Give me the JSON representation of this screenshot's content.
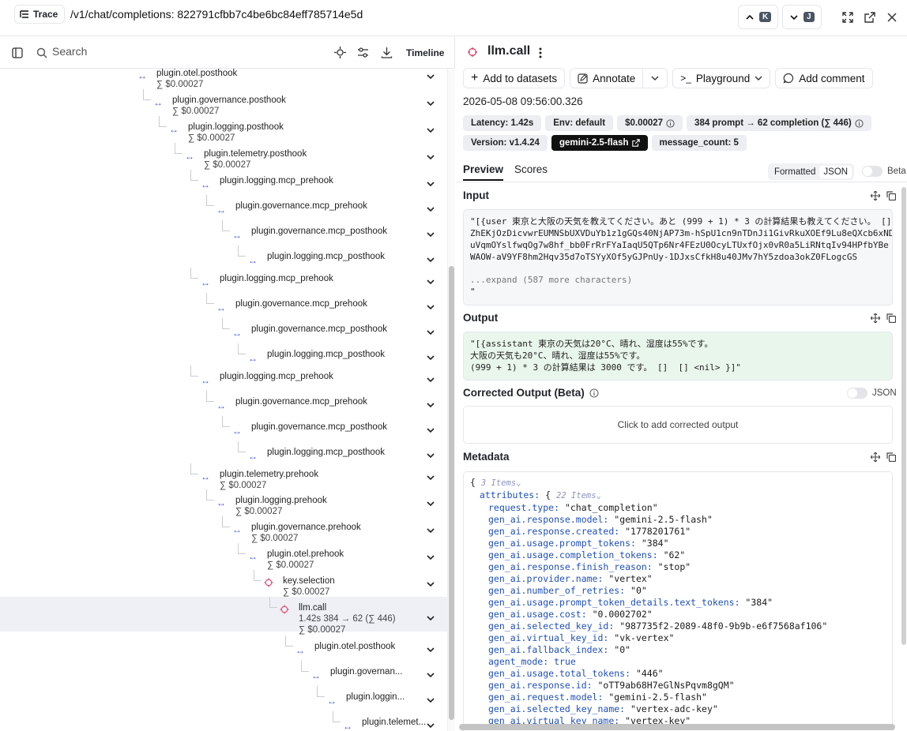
{
  "header": {
    "trace_label": "Trace",
    "path": "/v1/chat/completions: 822791cfbb7c4be6bc84eff785714e5d",
    "prev_key": "K",
    "next_key": "J"
  },
  "left": {
    "search_placeholder": "Search",
    "timeline_label": "Timeline",
    "tree": [
      {
        "name": "plugin.otel.posthook",
        "sub": "∑ $0.00027",
        "level": 0,
        "icon": "arrow"
      },
      {
        "name": "plugin.governance.posthook",
        "sub": "∑ $0.00027",
        "level": 1,
        "icon": "arrow"
      },
      {
        "name": "plugin.logging.posthook",
        "sub": "∑ $0.00027",
        "level": 2,
        "icon": "arrow"
      },
      {
        "name": "plugin.telemetry.posthook",
        "sub": "∑ $0.00027",
        "level": 3,
        "icon": "arrow"
      },
      {
        "name": "plugin.logging.mcp_prehook",
        "sub": "",
        "level": 4,
        "icon": "arrow"
      },
      {
        "name": "plugin.governance.mcp_prehook",
        "sub": "",
        "level": 5,
        "icon": "arrow"
      },
      {
        "name": "plugin.governance.mcp_posthook",
        "sub": "",
        "level": 6,
        "icon": "arrow"
      },
      {
        "name": "plugin.logging.mcp_posthook",
        "sub": "",
        "level": 7,
        "icon": "arrow"
      },
      {
        "name": "plugin.logging.mcp_prehook",
        "sub": "",
        "level": 4,
        "icon": "arrow"
      },
      {
        "name": "plugin.governance.mcp_prehook",
        "sub": "",
        "level": 5,
        "icon": "arrow"
      },
      {
        "name": "plugin.governance.mcp_posthook",
        "sub": "",
        "level": 6,
        "icon": "arrow"
      },
      {
        "name": "plugin.logging.mcp_posthook",
        "sub": "",
        "level": 7,
        "icon": "arrow"
      },
      {
        "name": "plugin.logging.mcp_prehook",
        "sub": "",
        "level": 4,
        "icon": "arrow"
      },
      {
        "name": "plugin.governance.mcp_prehook",
        "sub": "",
        "level": 5,
        "icon": "arrow"
      },
      {
        "name": "plugin.governance.mcp_posthook",
        "sub": "",
        "level": 6,
        "icon": "arrow"
      },
      {
        "name": "plugin.logging.mcp_posthook",
        "sub": "",
        "level": 7,
        "icon": "arrow"
      },
      {
        "name": "plugin.telemetry.prehook",
        "sub": "∑ $0.00027",
        "level": 4,
        "icon": "arrow"
      },
      {
        "name": "plugin.logging.prehook",
        "sub": "∑ $0.00027",
        "level": 5,
        "icon": "arrow"
      },
      {
        "name": "plugin.governance.prehook",
        "sub": "∑ $0.00027",
        "level": 6,
        "icon": "arrow"
      },
      {
        "name": "plugin.otel.prehook",
        "sub": "∑ $0.00027",
        "level": 7,
        "icon": "arrow"
      },
      {
        "name": "key.selection",
        "sub": "∑ $0.00027",
        "level": 8,
        "icon": "llm"
      },
      {
        "name": "llm.call",
        "sub": "1.42s   384 → 62 (∑ 446)",
        "sub2": "∑ $0.00027",
        "level": 9,
        "icon": "llm",
        "selected": true
      },
      {
        "name": "plugin.otel.posthook",
        "sub": "",
        "level": 10,
        "icon": "arrow"
      },
      {
        "name": "plugin.governan...",
        "sub": "",
        "level": 11,
        "icon": "arrow"
      },
      {
        "name": "plugin.loggin...",
        "sub": "",
        "level": 12,
        "icon": "arrow"
      },
      {
        "name": "plugin.telemet...",
        "sub": "",
        "level": 13,
        "icon": "arrow"
      }
    ]
  },
  "right": {
    "title": "llm.call",
    "buttons": {
      "add_to_datasets": "Add to datasets",
      "annotate": "Annotate",
      "playground": "Playground",
      "add_comment": "Add comment"
    },
    "timestamp": "2026-05-08 09:56:00.326",
    "badges": [
      {
        "label": "Latency: 1.42s",
        "dark": false,
        "info": false
      },
      {
        "label": "Env: default",
        "dark": false,
        "info": false
      },
      {
        "label": "$0.00027",
        "dark": false,
        "info": true
      },
      {
        "label": "384 prompt → 62 completion (∑ 446)",
        "dark": false,
        "info": true
      },
      {
        "label": "Version: v1.4.24",
        "dark": false,
        "info": false
      },
      {
        "label": "gemini-2.5-flash",
        "dark": true,
        "info": false,
        "link": true
      },
      {
        "label": "message_count: 5",
        "dark": false,
        "info": false
      }
    ],
    "tabs": {
      "preview": "Preview",
      "scores": "Scores"
    },
    "format_toggle": {
      "formatted": "Formatted",
      "json": "JSON"
    },
    "beta_label": "Beta",
    "input": {
      "heading": "Input",
      "lines": [
        "\"[{user 東京と大阪の天気を教えてください。あと (999 + 1) * 3 の計算結果も教えてください。 []",
        "ZhEKjOzDicvwrEUMNSbUXVDuYb1z1gGQs40NjAP73m-hSpU1cn9nTDnJi1GivRkuXOEf9Lu8eQXcb6xND",
        "uVqmOYslfwqOg7w8hf_bb0FrRrFYaIaqU5QTp6Nr4FEzU0OcyLTUxfOjx0vR0a5LiRNtqIv94HPfbYBe",
        "WAOW-aV9YF8hm2Hqv35d7oTSYyXOf5yGJPnUy-1DJxsCfkH8u40JMv7hY5zdoa3okZ0FLogcGS"
      ],
      "expand": "...expand (587 more characters)",
      "closing": "\""
    },
    "output": {
      "heading": "Output",
      "lines": [
        "\"[{assistant 東京の天気は20°C、晴れ、湿度は55%です。",
        "大阪の天気も20°C、晴れ、湿度は55%です。",
        "(999 + 1) * 3 の計算結果は 3000 です。 []  [] <nil> }]\""
      ]
    },
    "corrected": {
      "heading": "Corrected Output (Beta)",
      "json_label": "JSON",
      "placeholder": "Click to add corrected output"
    },
    "metadata": {
      "heading": "Metadata",
      "root_count": "3 Items",
      "attributes_key": "attributes",
      "attributes_count": "22 Items",
      "entries": [
        {
          "k": "request.type",
          "v": "\"chat_completion\""
        },
        {
          "k": "gen_ai.response.model",
          "v": "\"gemini-2.5-flash\""
        },
        {
          "k": "gen_ai.response.created",
          "v": "\"1778201761\""
        },
        {
          "k": "gen_ai.usage.prompt_tokens",
          "v": "\"384\""
        },
        {
          "k": "gen_ai.usage.completion_tokens",
          "v": "\"62\""
        },
        {
          "k": "gen_ai.response.finish_reason",
          "v": "\"stop\""
        },
        {
          "k": "gen_ai.provider.name",
          "v": "\"vertex\""
        },
        {
          "k": "gen_ai.number_of_retries",
          "v": "\"0\""
        },
        {
          "k": "gen_ai.usage.prompt_token_details.text_tokens",
          "v": "\"384\""
        },
        {
          "k": "gen_ai.usage.cost",
          "v": "\"0.0002702\""
        },
        {
          "k": "gen_ai.selected_key_id",
          "v": "\"987735f2-2089-48f0-9b9b-e6f7568af106\""
        },
        {
          "k": "gen_ai.virtual_key_id",
          "v": "\"vk-vertex\""
        },
        {
          "k": "gen_ai.fallback_index",
          "v": "\"0\""
        },
        {
          "k": "agent_mode",
          "v": "true"
        },
        {
          "k": "gen_ai.usage.total_tokens",
          "v": "\"446\""
        },
        {
          "k": "gen_ai.response.id",
          "v": "\"oTT9ab68H7eGlNsPqvm8gQM\""
        },
        {
          "k": "gen_ai.request.model",
          "v": "\"gemini-2.5-flash\""
        },
        {
          "k": "gen_ai.selected_key_name",
          "v": "\"vertex-adc-key\""
        },
        {
          "k": "gen_ai.virtual_key_name",
          "v": "\"vertex-key\""
        }
      ]
    }
  },
  "colors": {
    "accent_arrow": "#4f5bd5",
    "llm_icon": "#e0567a",
    "output_bg": "#e9f6ec"
  }
}
